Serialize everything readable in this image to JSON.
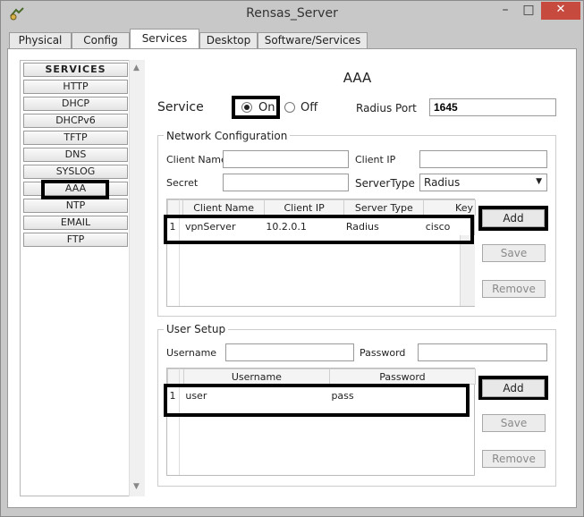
{
  "window": {
    "title": "Rensas_Server",
    "minimize": "–",
    "maximize": "□",
    "close": "✕"
  },
  "tabs": [
    "Physical",
    "Config",
    "Services",
    "Desktop",
    "Software/Services"
  ],
  "sidebar": {
    "header": "SERVICES",
    "items": [
      "HTTP",
      "DHCP",
      "DHCPv6",
      "TFTP",
      "DNS",
      "SYSLOG",
      "AAA",
      "NTP",
      "EMAIL",
      "FTP"
    ]
  },
  "aaa": {
    "title": "AAA",
    "service_label": "Service",
    "on_label": "On",
    "off_label": "Off",
    "radius_port_label": "Radius Port",
    "radius_port_value": "1645"
  },
  "network_config": {
    "legend": "Network Configuration",
    "client_name_label": "Client Name",
    "client_ip_label": "Client IP",
    "secret_label": "Secret",
    "server_type_label": "ServerType",
    "server_type_value": "Radius",
    "columns": [
      "Client Name",
      "Client IP",
      "Server Type",
      "Key"
    ],
    "rows": [
      {
        "index": "1",
        "client_name": "vpnServer",
        "client_ip": "10.2.0.1",
        "server_type": "Radius",
        "key": "cisco"
      }
    ],
    "buttons": {
      "add": "Add",
      "save": "Save",
      "remove": "Remove"
    }
  },
  "user_setup": {
    "legend": "User Setup",
    "username_label": "Username",
    "password_label": "Password",
    "columns": [
      "Username",
      "Password"
    ],
    "rows": [
      {
        "index": "1",
        "username": "user",
        "password": "pass"
      }
    ],
    "buttons": {
      "add": "Add",
      "save": "Save",
      "remove": "Remove"
    }
  }
}
